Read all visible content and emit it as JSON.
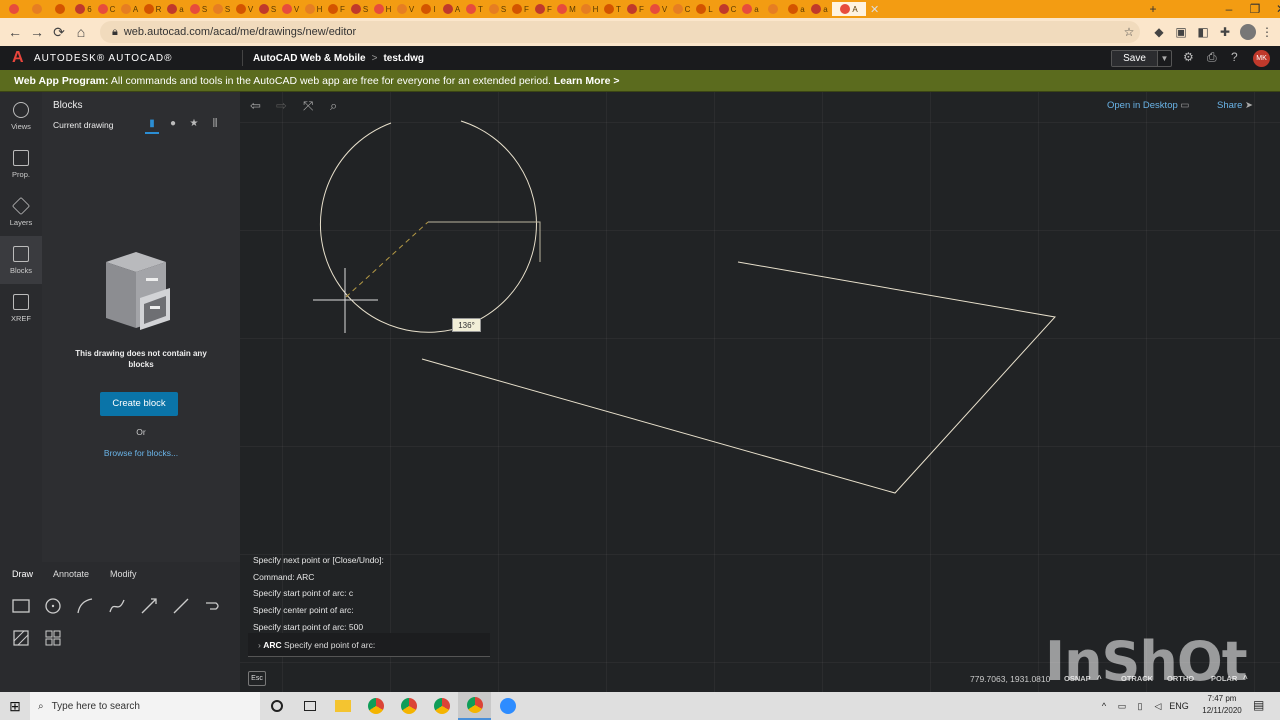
{
  "browser": {
    "url": "web.autocad.com/acad/me/drawings/new/editor",
    "tab_letters": [
      "",
      "",
      "",
      "6",
      "C",
      "A",
      "R",
      "a",
      "S",
      "S",
      "V",
      "S",
      "V",
      "H",
      "F",
      "S",
      "H",
      "V",
      "I",
      "A",
      "T",
      "S",
      "F",
      "F",
      "M",
      "H",
      "T",
      "F",
      "V",
      "C",
      "L",
      "C",
      "a",
      "",
      "a",
      "a",
      "A"
    ],
    "win_min": "–",
    "win_max": "❐",
    "win_close": "✕",
    "new_tab": "+",
    "close_tab": "✕"
  },
  "header": {
    "brand": "AUTODESK® AUTOCAD®",
    "crumb1": "AutoCAD Web & Mobile",
    "crumb_sep": ">",
    "crumb2": "test.dwg",
    "save_label": "Save",
    "avatar_initials": "MK"
  },
  "banner": {
    "lead": "Web App Program:",
    "text": " All commands and tools in the AutoCAD web app are free for everyone for an extended period. ",
    "link": "Learn More >"
  },
  "rail": [
    {
      "label": "Views"
    },
    {
      "label": "Prop."
    },
    {
      "label": "Layers"
    },
    {
      "label": "Blocks"
    },
    {
      "label": "XREF"
    }
  ],
  "panel": {
    "title": "Blocks",
    "subtitle": "Current drawing",
    "empty_message": "This drawing does not contain any blocks",
    "create_button": "Create block",
    "or": "Or",
    "browse": "Browse for blocks..."
  },
  "drawbar": {
    "tabs": [
      "Draw",
      "Annotate",
      "Modify"
    ]
  },
  "canvas": {
    "open_desktop": "Open in Desktop",
    "share": "Share",
    "angle_tooltip": "136°"
  },
  "command": {
    "history": [
      "Specify next point or [Close/Undo]:",
      "Command: ARC",
      "Specify start point of arc: c",
      "Specify center point of arc:",
      "Specify start point of arc: 500"
    ],
    "prompt_cmd": "ARC",
    "prompt_text": " Specify end point of arc:",
    "esc": "Esc"
  },
  "status": {
    "coords": "779.7063, 1931.0810",
    "toggles": [
      "OSNAP",
      "OTRACK",
      "ORTHO",
      "POLAR"
    ]
  },
  "watermark": "InShOt",
  "taskbar": {
    "search_placeholder": "Type here to search",
    "lang": "ENG",
    "time": "7:47 pm",
    "date": "12/11/2020"
  }
}
